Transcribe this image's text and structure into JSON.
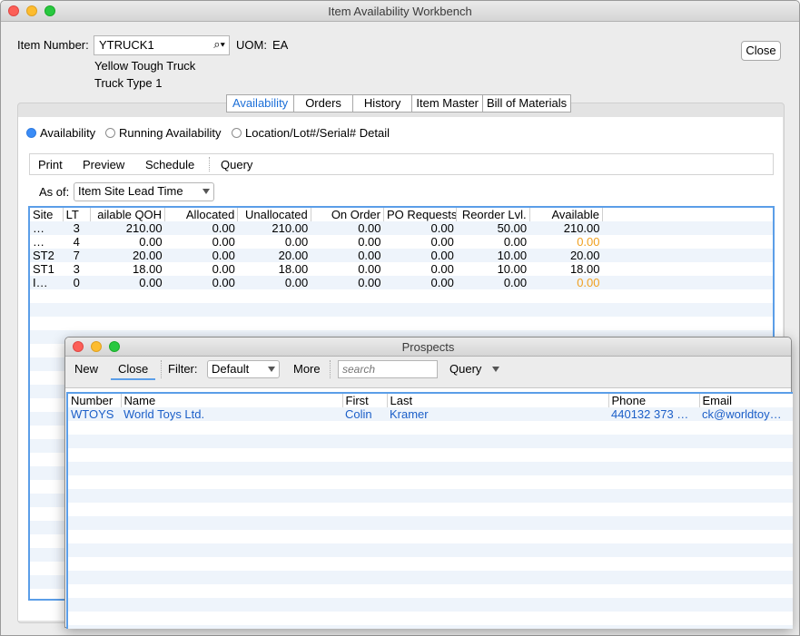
{
  "main_window": {
    "title": "Item Availability Workbench",
    "item_number_label": "Item Number:",
    "item_number_value": "YTRUCK1",
    "uom_label": "UOM:",
    "uom_value": "EA",
    "description_1": "Yellow Tough Truck",
    "description_2": "Truck Type 1",
    "close_label": "Close",
    "tabs": [
      "Availability",
      "Orders",
      "History",
      "Item Master",
      "Bill of Materials"
    ],
    "active_tab": "Availability",
    "radios": [
      {
        "label": "Availability",
        "selected": true
      },
      {
        "label": "Running Availability",
        "selected": false
      },
      {
        "label": "Location/Lot#/Serial# Detail",
        "selected": false
      }
    ],
    "toolbar": {
      "print": "Print",
      "preview": "Preview",
      "schedule": "Schedule",
      "query": "Query"
    },
    "as_of_label": "As of:",
    "as_of_value": "Item Site Lead Time",
    "table": {
      "headers": [
        "Site",
        "LT",
        "ailable QOH",
        "Allocated",
        "Unallocated",
        "On Order",
        "PO Requests",
        "Reorder Lvl.",
        "Available"
      ],
      "rows": [
        [
          "…",
          "3",
          "210.00",
          "0.00",
          "210.00",
          "0.00",
          "0.00",
          "50.00",
          "210.00"
        ],
        [
          "…",
          "4",
          "0.00",
          "0.00",
          "0.00",
          "0.00",
          "0.00",
          "0.00",
          "0.00"
        ],
        [
          "ST2",
          "7",
          "20.00",
          "0.00",
          "20.00",
          "0.00",
          "0.00",
          "10.00",
          "20.00"
        ],
        [
          "ST1",
          "3",
          "18.00",
          "0.00",
          "18.00",
          "0.00",
          "0.00",
          "10.00",
          "18.00"
        ],
        [
          "I…",
          "0",
          "0.00",
          "0.00",
          "0.00",
          "0.00",
          "0.00",
          "0.00",
          "0.00"
        ]
      ],
      "highlight_color": "#f0a020"
    }
  },
  "prospects_window": {
    "title": "Prospects",
    "new_label": "New",
    "close_label": "Close",
    "filter_label": "Filter:",
    "filter_value": "Default",
    "more_label": "More",
    "search_placeholder": "search",
    "query_label": "Query",
    "table": {
      "headers": [
        "Number",
        "Name",
        "First",
        "Last",
        "Phone",
        "Email"
      ],
      "rows": [
        [
          "WTOYS",
          "World Toys Ltd.",
          "Colin",
          "Kramer",
          "440132 373 …",
          "ck@worldtoy…"
        ]
      ]
    }
  },
  "colors": {
    "accent": "#1c6fd8",
    "selection_border": "#5b9ee8"
  }
}
